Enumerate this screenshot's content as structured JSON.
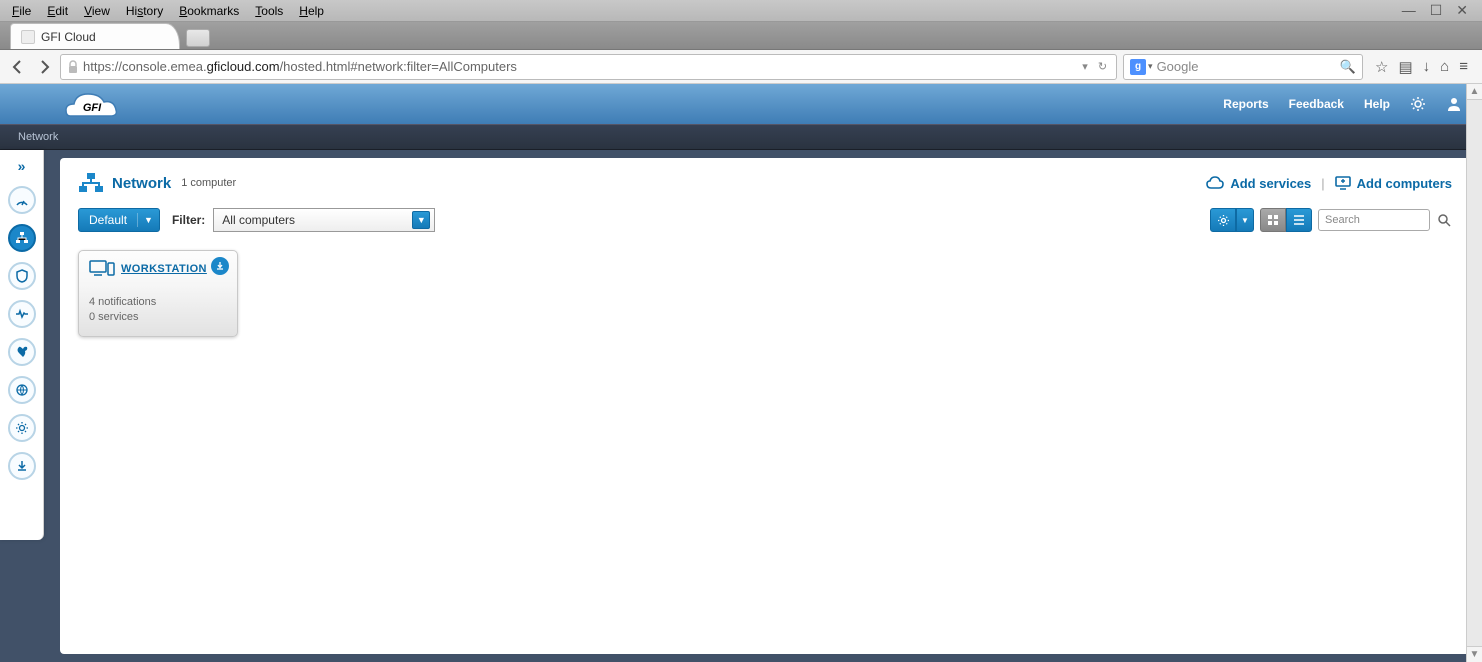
{
  "os_menu": [
    "File",
    "Edit",
    "View",
    "History",
    "Bookmarks",
    "Tools",
    "Help"
  ],
  "browser_tab": {
    "title": "GFI Cloud"
  },
  "url": {
    "prefix": "https://console.emea.",
    "domain": "gficloud.com",
    "suffix": "/hosted.html#network:filter=AllComputers"
  },
  "search_engine_placeholder": "Google",
  "header_links": {
    "reports": "Reports",
    "feedback": "Feedback",
    "help": "Help"
  },
  "breadcrumb": "Network",
  "page": {
    "title": "Network",
    "count": "1 computer",
    "add_services": "Add services",
    "add_computers": "Add computers",
    "default_button": "Default",
    "filter_label": "Filter:",
    "filter_value": "All computers",
    "search_placeholder": "Search"
  },
  "device": {
    "name": "WORKSTATION",
    "notifications": "4 notifications",
    "services": "0 services"
  }
}
